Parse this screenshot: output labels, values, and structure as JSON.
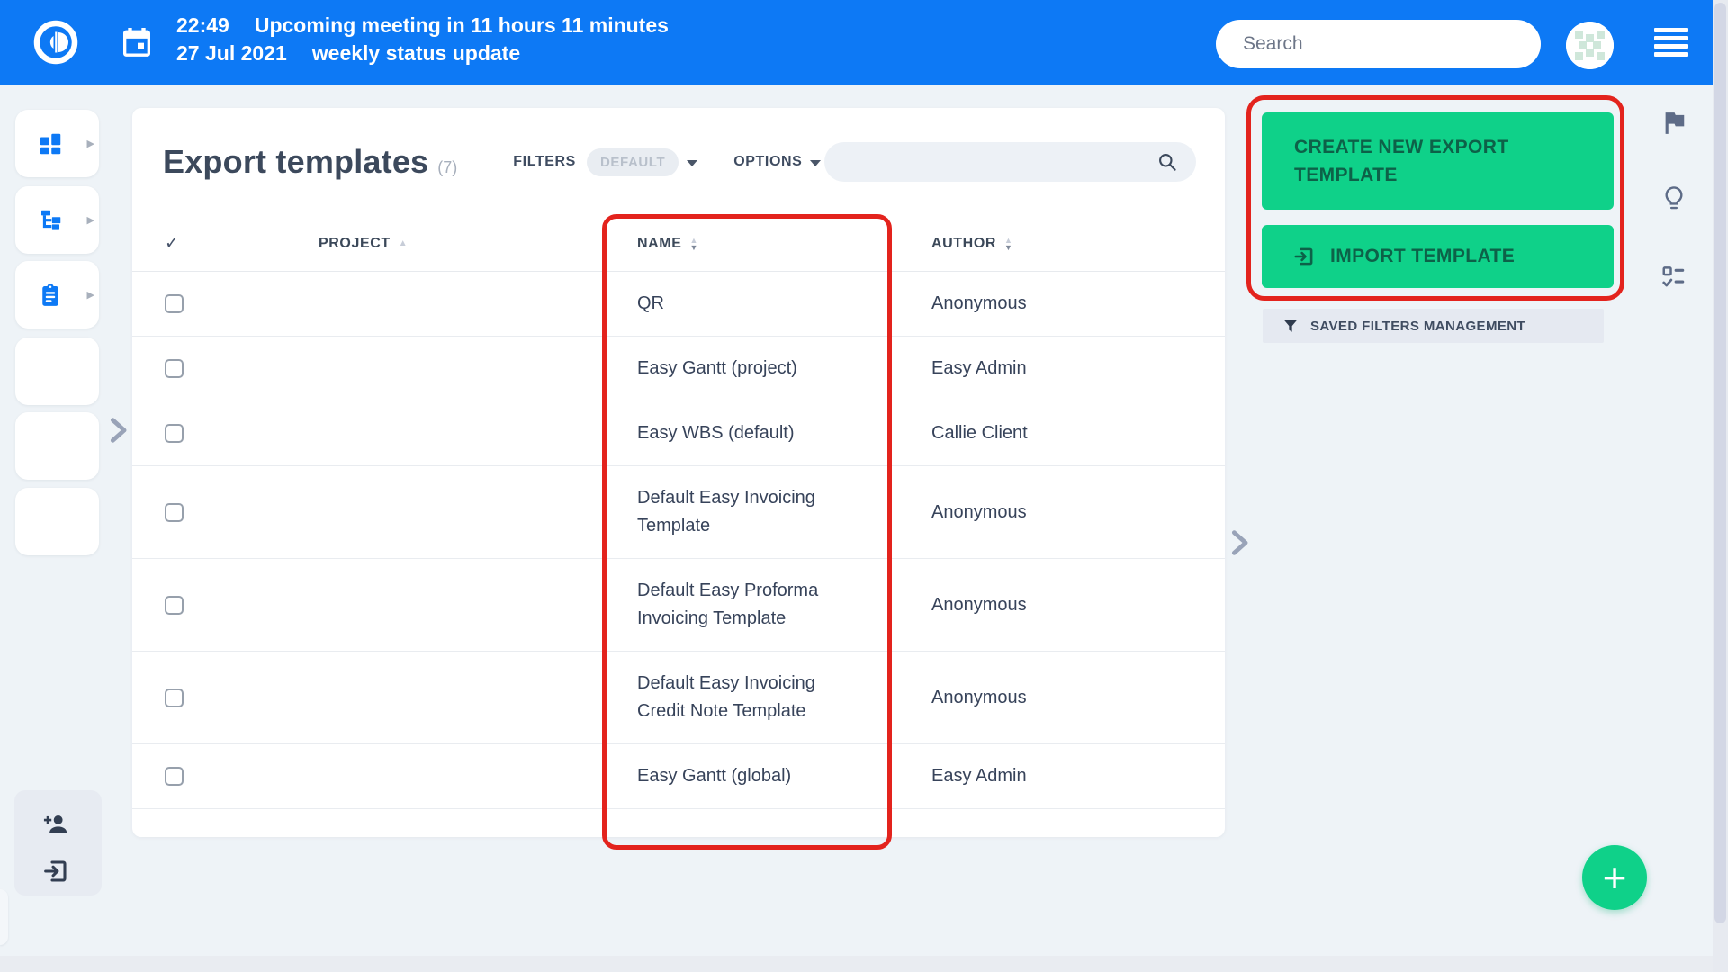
{
  "header": {
    "time": "22:49",
    "notice": "Upcoming meeting in 11 hours 11 minutes",
    "date": "27 Jul 2021",
    "note": "weekly status update",
    "search_placeholder": "Search"
  },
  "toolbar": {
    "title": "Export templates",
    "count": "(7)",
    "filters_label": "FILTERS",
    "filters_value": "DEFAULT",
    "options_label": "OPTIONS"
  },
  "table": {
    "select_all_glyph": "✓",
    "columns": [
      {
        "label": "PROJECT",
        "sort": "asc"
      },
      {
        "label": "NAME",
        "sort": "none"
      },
      {
        "label": "AUTHOR",
        "sort": "none"
      }
    ],
    "rows": [
      {
        "project": "",
        "name": "QR",
        "author": "Anonymous"
      },
      {
        "project": "",
        "name": "Easy Gantt (project)",
        "author": "Easy Admin"
      },
      {
        "project": "",
        "name": "Easy WBS (default)",
        "author": "Callie Client"
      },
      {
        "project": "",
        "name": "Default Easy Invoicing Template",
        "author": "Anonymous"
      },
      {
        "project": "",
        "name": "Default Easy Proforma Invoicing Template",
        "author": "Anonymous"
      },
      {
        "project": "",
        "name": "Default Easy Invoicing Credit Note Template",
        "author": "Anonymous"
      },
      {
        "project": "",
        "name": "Easy Gantt (global)",
        "author": "Easy Admin"
      }
    ]
  },
  "actions": {
    "create_label": "CREATE NEW EXPORT TEMPLATE",
    "import_label": "IMPORT TEMPLATE",
    "saved_filters_label": "SAVED FILTERS MANAGEMENT",
    "fab_glyph": "+"
  },
  "icons": [
    "app-logo-icon",
    "calendar-icon",
    "avatar",
    "hamburger-menu-icon",
    "dashboard-icon",
    "tree-icon",
    "clipboard-icon",
    "chevron-right-icon",
    "add-user-icon",
    "login-icon",
    "search-icon",
    "funnel-icon",
    "flag-icon",
    "lightbulb-icon",
    "checklist-icon",
    "import-icon",
    "plus-icon"
  ],
  "colors": {
    "header_blue": "#0d79f5",
    "accent_green": "#0fd189",
    "green_text": "#0d6148",
    "annotation_red": "#e3231d",
    "slate_text": "#3c495c",
    "page_bg": "#eef3f7"
  }
}
